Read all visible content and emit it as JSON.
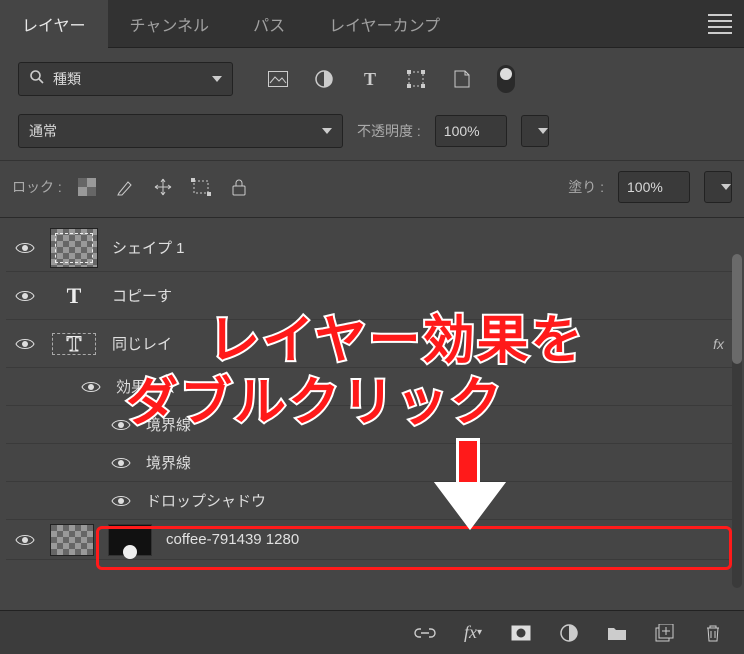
{
  "tabs": {
    "items": [
      "レイヤー",
      "チャンネル",
      "パス",
      "レイヤーカンプ"
    ],
    "active_index": 0
  },
  "filter": {
    "search_placeholder": "種類"
  },
  "blend": {
    "mode": "通常",
    "opacity_label": "不透明度 :",
    "opacity_value": "100%"
  },
  "lock": {
    "label": "ロック :",
    "fill_label": "塗り :",
    "fill_value": "100%"
  },
  "layers": [
    {
      "name": "シェイプ 1",
      "type": "shape"
    },
    {
      "name": "コピーす",
      "type": "text"
    },
    {
      "name": "同じレイ",
      "type": "text-outline",
      "fx": true
    },
    {
      "name": "coffee-791439 1280",
      "type": "image"
    }
  ],
  "effects": {
    "header": "効果",
    "items": [
      "境界線",
      "境界線",
      "ドロップシャドウ"
    ]
  },
  "annotation": {
    "line1": "レイヤー効果を",
    "line2": "ダブルクリック"
  }
}
